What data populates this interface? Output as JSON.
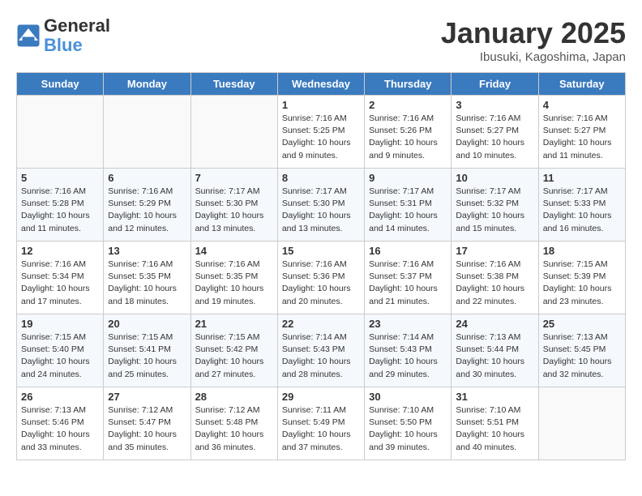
{
  "header": {
    "logo_line1": "General",
    "logo_line2": "Blue",
    "month_title": "January 2025",
    "location": "Ibusuki, Kagoshima, Japan"
  },
  "weekdays": [
    "Sunday",
    "Monday",
    "Tuesday",
    "Wednesday",
    "Thursday",
    "Friday",
    "Saturday"
  ],
  "weeks": [
    [
      {
        "day": "",
        "info": ""
      },
      {
        "day": "",
        "info": ""
      },
      {
        "day": "",
        "info": ""
      },
      {
        "day": "1",
        "info": "Sunrise: 7:16 AM\nSunset: 5:25 PM\nDaylight: 10 hours\nand 9 minutes."
      },
      {
        "day": "2",
        "info": "Sunrise: 7:16 AM\nSunset: 5:26 PM\nDaylight: 10 hours\nand 9 minutes."
      },
      {
        "day": "3",
        "info": "Sunrise: 7:16 AM\nSunset: 5:27 PM\nDaylight: 10 hours\nand 10 minutes."
      },
      {
        "day": "4",
        "info": "Sunrise: 7:16 AM\nSunset: 5:27 PM\nDaylight: 10 hours\nand 11 minutes."
      }
    ],
    [
      {
        "day": "5",
        "info": "Sunrise: 7:16 AM\nSunset: 5:28 PM\nDaylight: 10 hours\nand 11 minutes."
      },
      {
        "day": "6",
        "info": "Sunrise: 7:16 AM\nSunset: 5:29 PM\nDaylight: 10 hours\nand 12 minutes."
      },
      {
        "day": "7",
        "info": "Sunrise: 7:17 AM\nSunset: 5:30 PM\nDaylight: 10 hours\nand 13 minutes."
      },
      {
        "day": "8",
        "info": "Sunrise: 7:17 AM\nSunset: 5:30 PM\nDaylight: 10 hours\nand 13 minutes."
      },
      {
        "day": "9",
        "info": "Sunrise: 7:17 AM\nSunset: 5:31 PM\nDaylight: 10 hours\nand 14 minutes."
      },
      {
        "day": "10",
        "info": "Sunrise: 7:17 AM\nSunset: 5:32 PM\nDaylight: 10 hours\nand 15 minutes."
      },
      {
        "day": "11",
        "info": "Sunrise: 7:17 AM\nSunset: 5:33 PM\nDaylight: 10 hours\nand 16 minutes."
      }
    ],
    [
      {
        "day": "12",
        "info": "Sunrise: 7:16 AM\nSunset: 5:34 PM\nDaylight: 10 hours\nand 17 minutes."
      },
      {
        "day": "13",
        "info": "Sunrise: 7:16 AM\nSunset: 5:35 PM\nDaylight: 10 hours\nand 18 minutes."
      },
      {
        "day": "14",
        "info": "Sunrise: 7:16 AM\nSunset: 5:35 PM\nDaylight: 10 hours\nand 19 minutes."
      },
      {
        "day": "15",
        "info": "Sunrise: 7:16 AM\nSunset: 5:36 PM\nDaylight: 10 hours\nand 20 minutes."
      },
      {
        "day": "16",
        "info": "Sunrise: 7:16 AM\nSunset: 5:37 PM\nDaylight: 10 hours\nand 21 minutes."
      },
      {
        "day": "17",
        "info": "Sunrise: 7:16 AM\nSunset: 5:38 PM\nDaylight: 10 hours\nand 22 minutes."
      },
      {
        "day": "18",
        "info": "Sunrise: 7:15 AM\nSunset: 5:39 PM\nDaylight: 10 hours\nand 23 minutes."
      }
    ],
    [
      {
        "day": "19",
        "info": "Sunrise: 7:15 AM\nSunset: 5:40 PM\nDaylight: 10 hours\nand 24 minutes."
      },
      {
        "day": "20",
        "info": "Sunrise: 7:15 AM\nSunset: 5:41 PM\nDaylight: 10 hours\nand 25 minutes."
      },
      {
        "day": "21",
        "info": "Sunrise: 7:15 AM\nSunset: 5:42 PM\nDaylight: 10 hours\nand 27 minutes."
      },
      {
        "day": "22",
        "info": "Sunrise: 7:14 AM\nSunset: 5:43 PM\nDaylight: 10 hours\nand 28 minutes."
      },
      {
        "day": "23",
        "info": "Sunrise: 7:14 AM\nSunset: 5:43 PM\nDaylight: 10 hours\nand 29 minutes."
      },
      {
        "day": "24",
        "info": "Sunrise: 7:13 AM\nSunset: 5:44 PM\nDaylight: 10 hours\nand 30 minutes."
      },
      {
        "day": "25",
        "info": "Sunrise: 7:13 AM\nSunset: 5:45 PM\nDaylight: 10 hours\nand 32 minutes."
      }
    ],
    [
      {
        "day": "26",
        "info": "Sunrise: 7:13 AM\nSunset: 5:46 PM\nDaylight: 10 hours\nand 33 minutes."
      },
      {
        "day": "27",
        "info": "Sunrise: 7:12 AM\nSunset: 5:47 PM\nDaylight: 10 hours\nand 35 minutes."
      },
      {
        "day": "28",
        "info": "Sunrise: 7:12 AM\nSunset: 5:48 PM\nDaylight: 10 hours\nand 36 minutes."
      },
      {
        "day": "29",
        "info": "Sunrise: 7:11 AM\nSunset: 5:49 PM\nDaylight: 10 hours\nand 37 minutes."
      },
      {
        "day": "30",
        "info": "Sunrise: 7:10 AM\nSunset: 5:50 PM\nDaylight: 10 hours\nand 39 minutes."
      },
      {
        "day": "31",
        "info": "Sunrise: 7:10 AM\nSunset: 5:51 PM\nDaylight: 10 hours\nand 40 minutes."
      },
      {
        "day": "",
        "info": ""
      }
    ]
  ]
}
